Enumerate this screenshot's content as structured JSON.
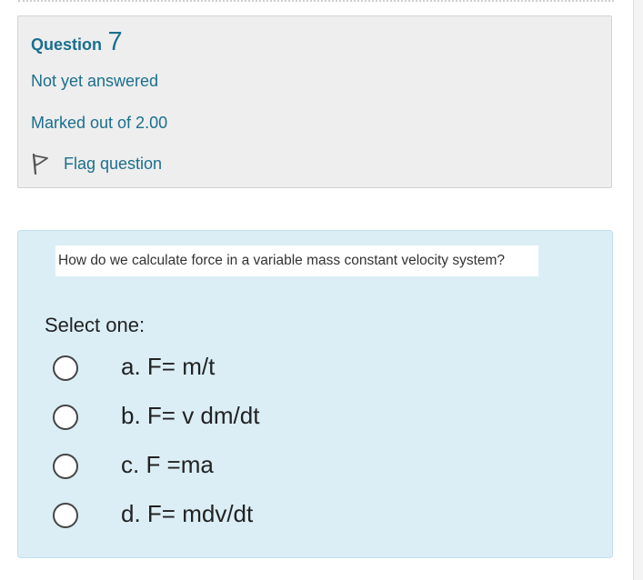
{
  "question_info": {
    "question_label": "Question",
    "question_number": "7",
    "state": "Not yet answered",
    "grade": "Marked out of 2.00",
    "flag_label": "Flag question",
    "flag_icon": "flag-icon",
    "accent_color": "#1a6f8e"
  },
  "content": {
    "question_text": "How do we calculate force in a variable mass constant velocity system?",
    "prompt": "Select one:",
    "answers": [
      {
        "label": "a. F= m/t"
      },
      {
        "label": "b. F= v dm/dt"
      },
      {
        "label": "c. F =ma"
      },
      {
        "label": "d. F= mdv/dt"
      }
    ],
    "background_color": "#dbeef6"
  }
}
